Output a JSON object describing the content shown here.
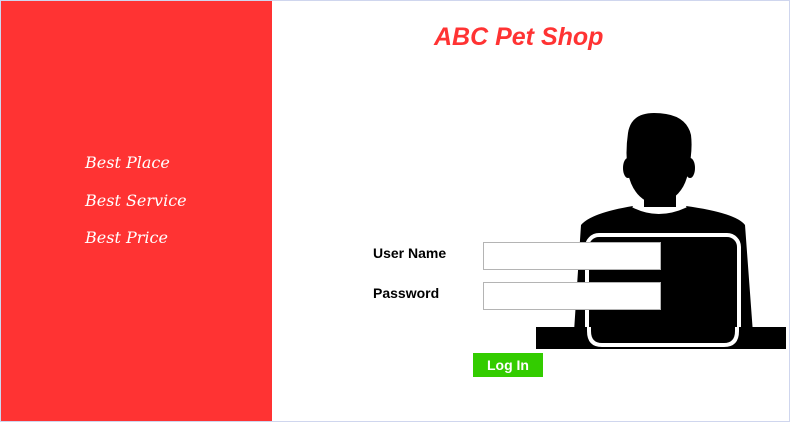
{
  "app": {
    "title": "ABC Pet Shop",
    "brand_color": "#ff3333"
  },
  "sidebar": {
    "slogans": [
      "Best Place",
      "Best Service",
      "Best Price"
    ]
  },
  "login_form": {
    "username_label": "User Name",
    "username_value": "",
    "password_label": "Password",
    "password_value": "",
    "login_button_label": "Log In",
    "login_button_color": "#33cc00"
  },
  "illustration": {
    "icon": "user-at-laptop-icon"
  }
}
